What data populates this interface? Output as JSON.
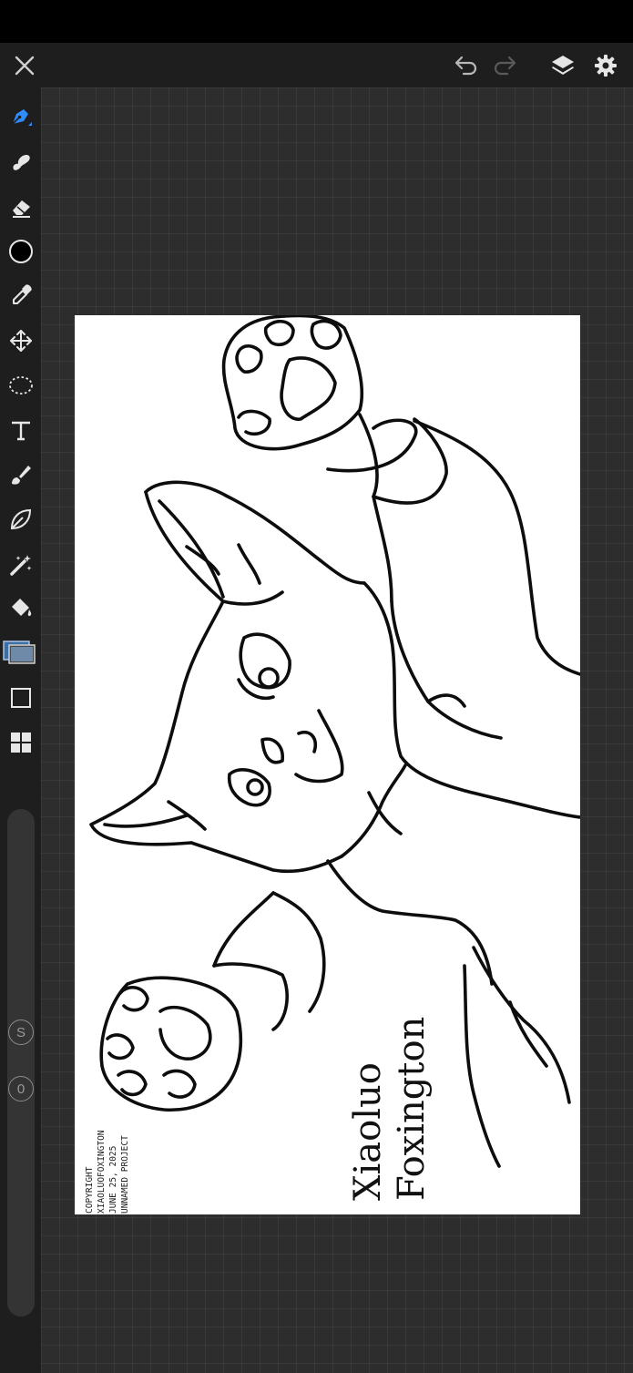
{
  "toolbar": {
    "close_icon": "close-icon",
    "undo_icon": "undo-icon",
    "redo_icon": "redo-icon",
    "layers_icon": "layers-icon",
    "settings_icon": "gear-icon"
  },
  "tools": [
    {
      "name": "brush-tool",
      "icon": "pen-icon",
      "active": true
    },
    {
      "name": "smudge-tool",
      "icon": "smudge-icon"
    },
    {
      "name": "eraser-tool",
      "icon": "eraser-icon"
    },
    {
      "name": "color-swatch",
      "icon": "color-circle",
      "color": "#000000"
    },
    {
      "name": "eyedropper-tool",
      "icon": "eyedropper-icon"
    },
    {
      "name": "transform-tool",
      "icon": "move-icon"
    },
    {
      "name": "lasso-tool",
      "icon": "lasso-icon"
    },
    {
      "name": "text-tool",
      "icon": "text-icon"
    },
    {
      "name": "airbrush-tool",
      "icon": "airbrush-icon"
    },
    {
      "name": "vector-tool",
      "icon": "leaf-icon"
    },
    {
      "name": "magic-wand-tool",
      "icon": "magic-wand-icon"
    },
    {
      "name": "fill-tool",
      "icon": "paint-bucket-icon"
    },
    {
      "name": "layers-panel-tool",
      "icon": "layers-thumbnail-icon"
    },
    {
      "name": "shape-tool",
      "icon": "square-icon"
    },
    {
      "name": "more-tools",
      "icon": "grid-icon"
    }
  ],
  "slider": {
    "size_label": "S",
    "opacity_label": "0"
  },
  "artwork": {
    "copyright_lines": [
      "COPYRIGHT",
      "XIAOLUOFOXINGTON",
      "JUNE 25, 2025",
      "UNNAMED PROJECT"
    ],
    "signature_lines": [
      "Xiaoluo",
      "Foxington"
    ]
  },
  "colors": {
    "accent": "#2f8cff",
    "toolbar": "#1e1e1e",
    "canvas_bg": "#2d2d2d",
    "paper": "#ffffff"
  }
}
